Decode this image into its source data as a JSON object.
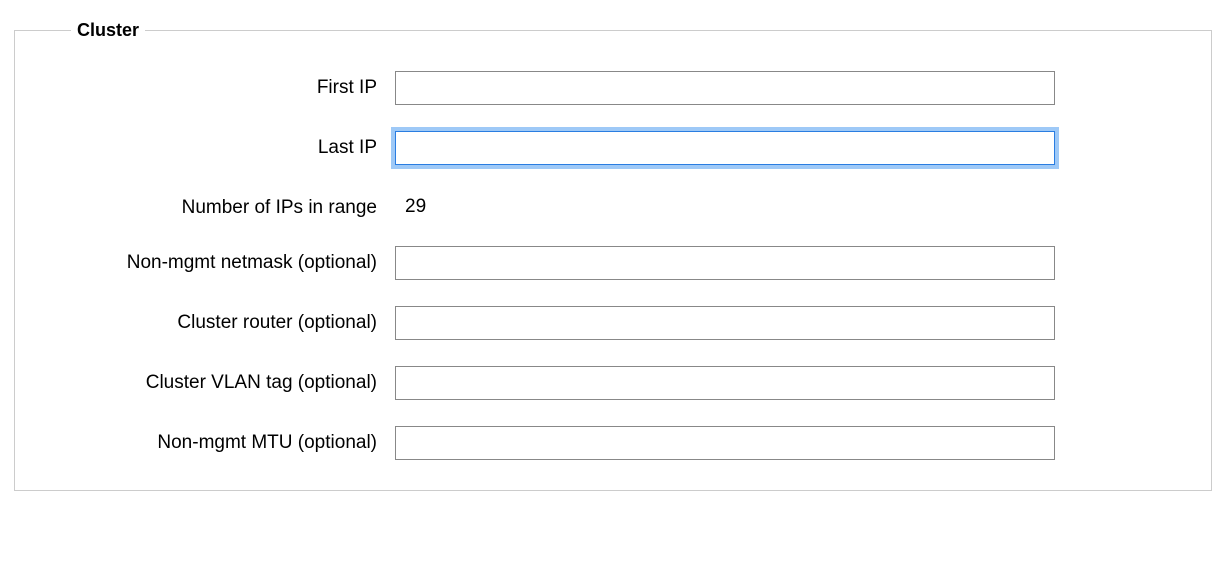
{
  "fieldset": {
    "legend": "Cluster",
    "rows": {
      "first_ip": {
        "label": "First IP",
        "value": ""
      },
      "last_ip": {
        "label": "Last IP",
        "value": ""
      },
      "num_ips": {
        "label": "Number of IPs in range",
        "value": "29"
      },
      "netmask": {
        "label": "Non-mgmt netmask (optional)",
        "value": ""
      },
      "router": {
        "label": "Cluster router (optional)",
        "value": ""
      },
      "vlan": {
        "label": "Cluster VLAN tag (optional)",
        "value": ""
      },
      "mtu": {
        "label": "Non-mgmt MTU (optional)",
        "value": ""
      }
    }
  }
}
